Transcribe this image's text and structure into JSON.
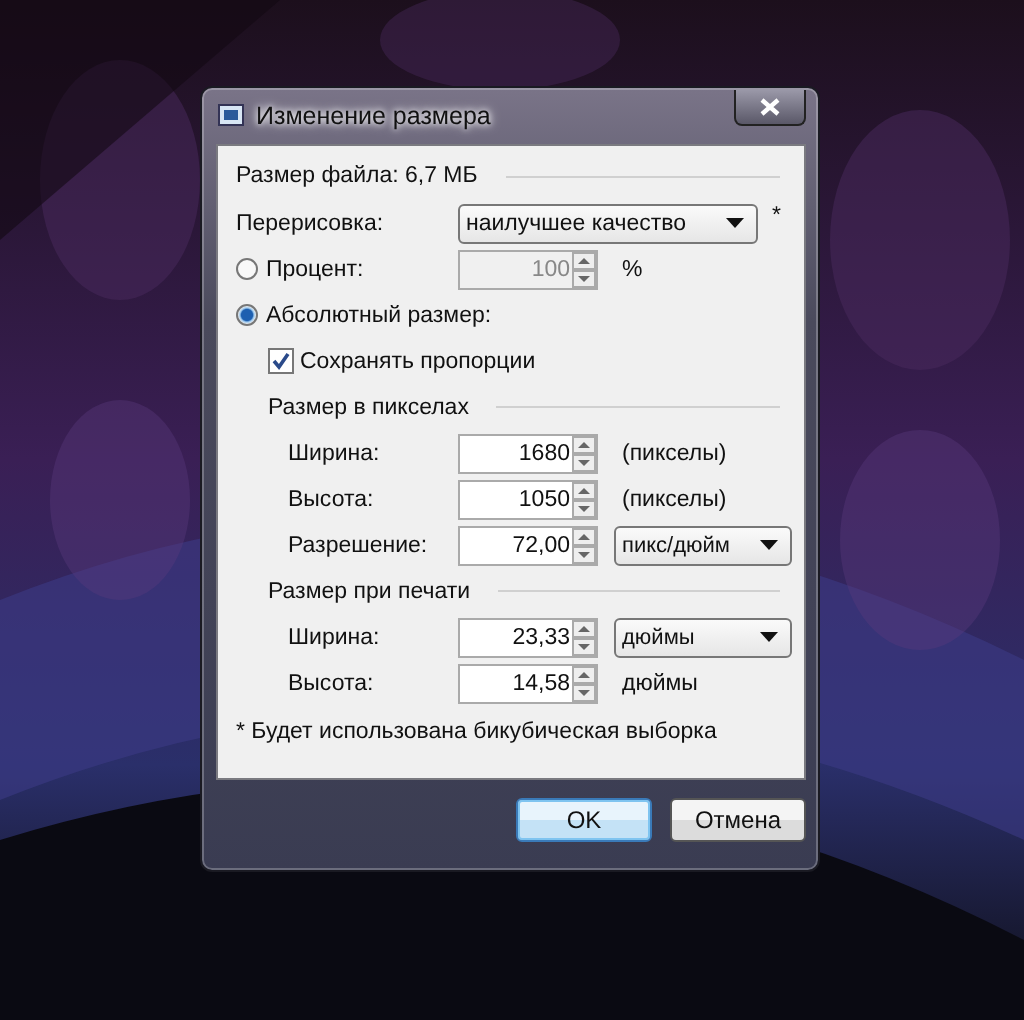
{
  "window": {
    "title": "Изменение размера"
  },
  "file_size": "Размер файла: 6,7 МБ",
  "resample": {
    "label": "Перерисовка:",
    "value": "наилучшее качество",
    "note": "*"
  },
  "percent": {
    "label": "Процент:",
    "selected": false,
    "value": "100",
    "disabled": true,
    "unit": "%"
  },
  "absolute": {
    "label": "Абсолютный размер:",
    "selected": true
  },
  "keep_proportions": {
    "label": "Сохранять пропорции",
    "checked": true
  },
  "sections": [
    {
      "title": "Размер в пикселах",
      "rows": [
        {
          "label": "Ширина:",
          "value": "1680",
          "unit": {
            "kind": "text",
            "text": "(пикселы)"
          }
        },
        {
          "label": "Высота:",
          "value": "1050",
          "unit": {
            "kind": "text",
            "text": "(пикселы)"
          }
        },
        {
          "label": "Разрешение:",
          "value": "72,00",
          "unit": {
            "kind": "dropdown",
            "text": "пикс/дюйм"
          }
        }
      ]
    },
    {
      "title": "Размер при печати",
      "rows": [
        {
          "label": "Ширина:",
          "value": "23,33",
          "unit": {
            "kind": "dropdown",
            "text": "дюймы"
          }
        },
        {
          "label": "Высота:",
          "value": "14,58",
          "unit": {
            "kind": "text",
            "text": "дюймы"
          }
        }
      ]
    }
  ],
  "footnote": "* Будет использована бикубическая выборка",
  "buttons": [
    {
      "label": "OK",
      "default": true
    },
    {
      "label": "Отмена",
      "default": false
    }
  ]
}
